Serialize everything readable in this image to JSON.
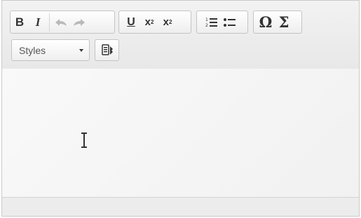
{
  "toolbar": {
    "bold_label": "B",
    "italic_label": "I",
    "underline_label": "U",
    "subscript_label": "x",
    "subscript_mark": "2",
    "superscript_label": "x",
    "superscript_mark": "2",
    "special_char_label": "Ω",
    "math_label": "Σ",
    "undo_icon": "undo-arrow-icon",
    "redo_icon": "redo-arrow-icon",
    "numbered_list_icon": "numbered-list-icon",
    "bulleted_list_icon": "bulleted-list-icon",
    "template_icon": "template-icon"
  },
  "styles_dropdown": {
    "selected": "Styles"
  },
  "colors": {
    "toolbar_bg": "#efefef",
    "icon": "#333333",
    "disabled_icon": "#b9b9b9"
  }
}
